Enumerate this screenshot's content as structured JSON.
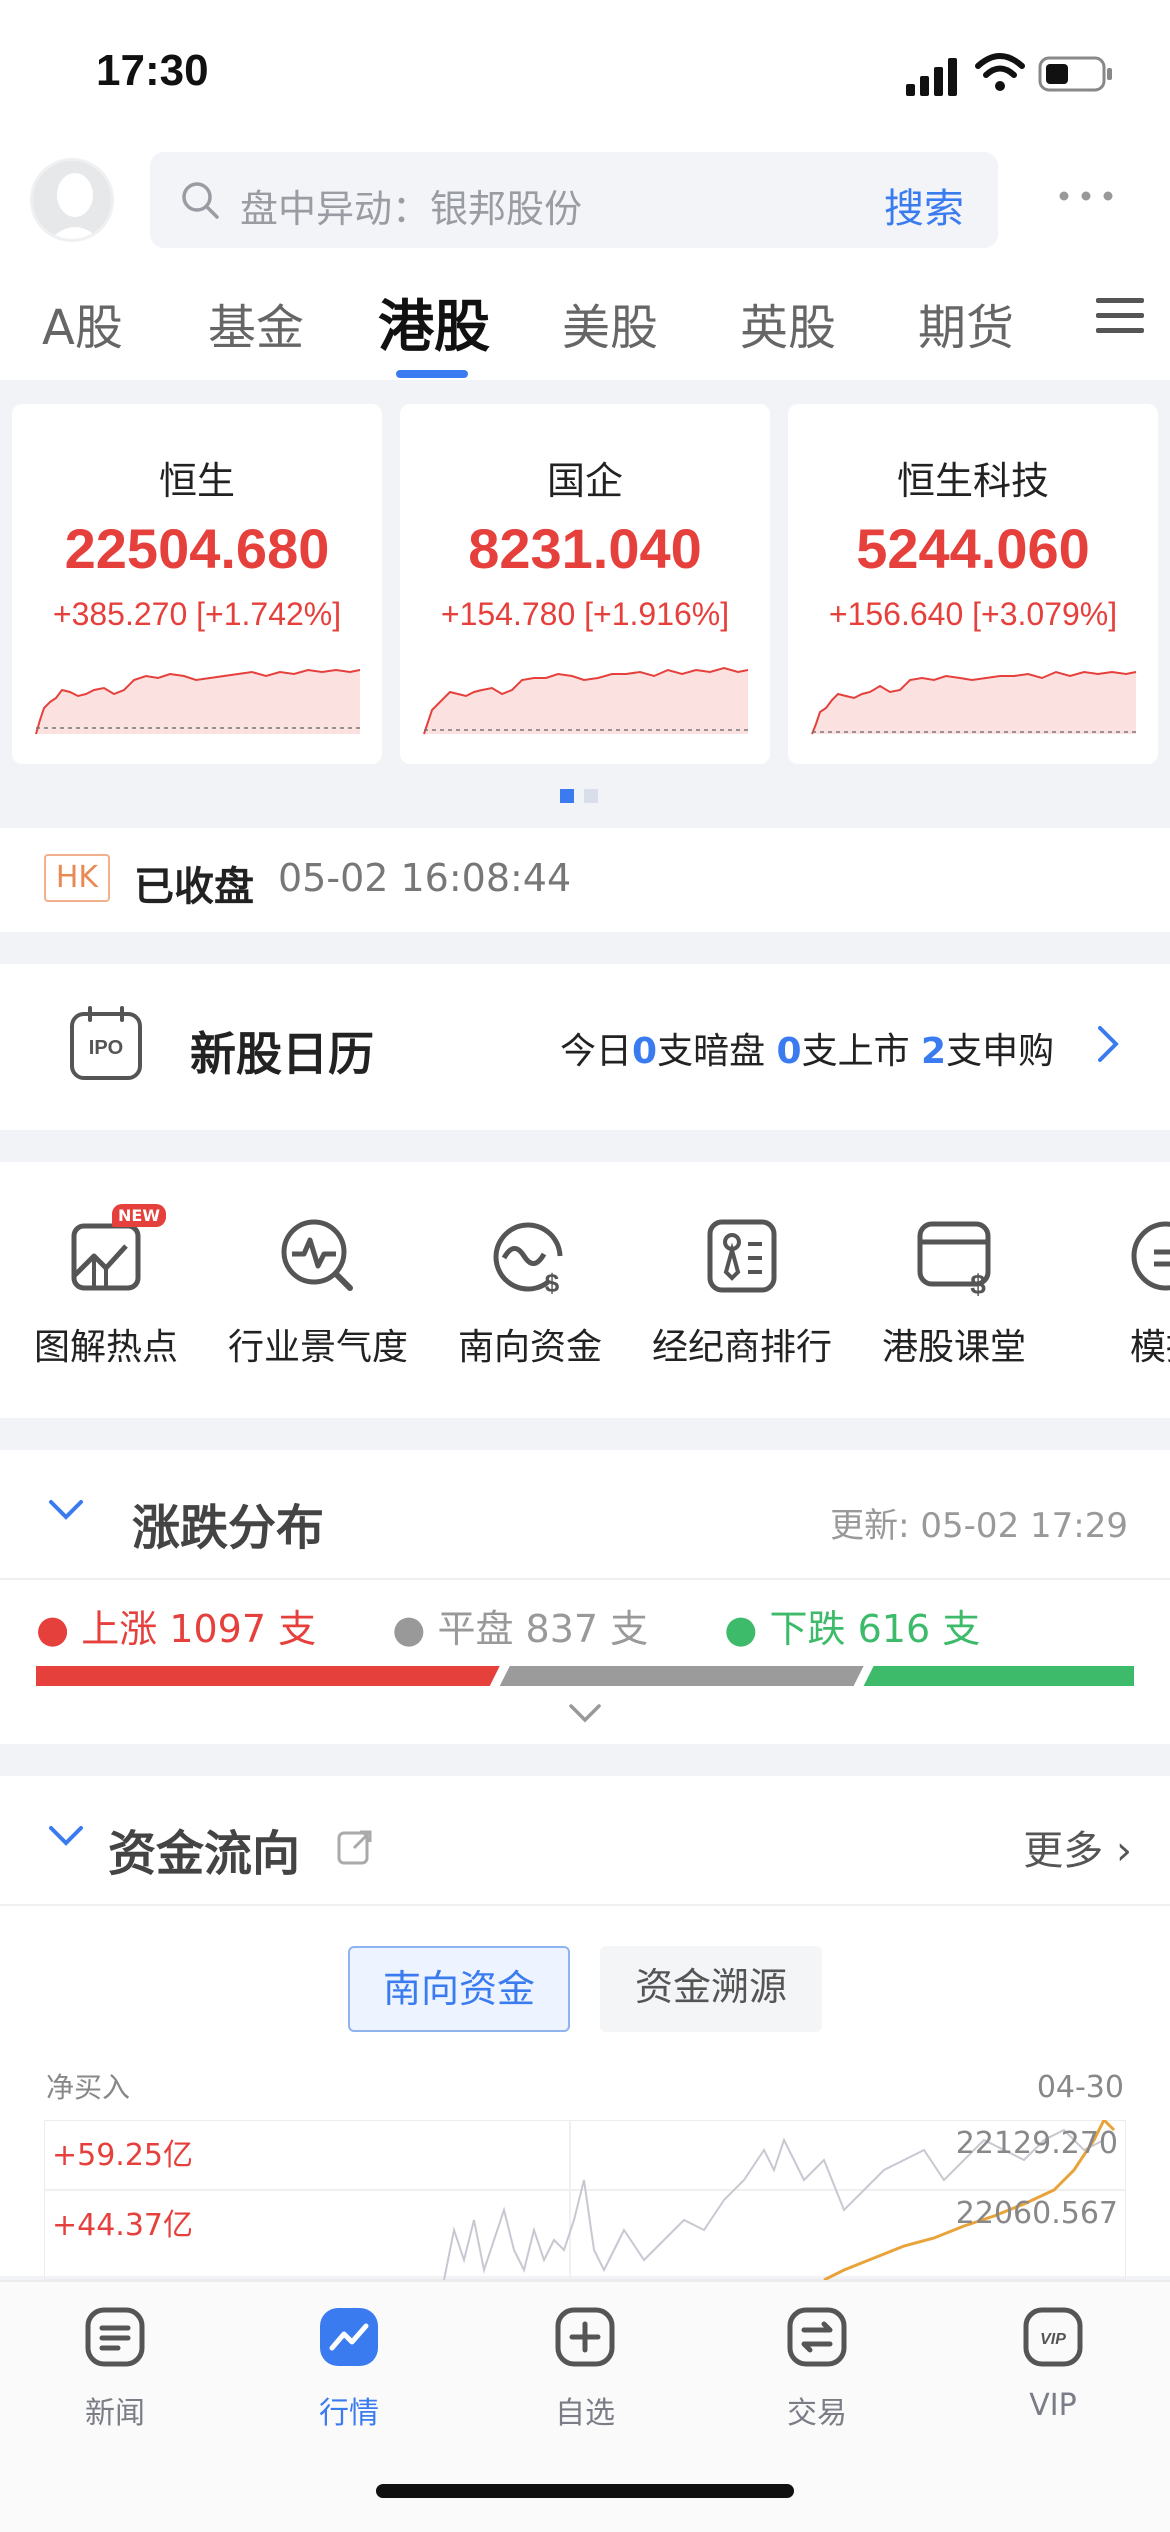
{
  "status_bar": {
    "time": "17:30"
  },
  "header": {
    "search_placeholder": "盘中异动：银邦股份",
    "search_button": "搜索",
    "tabs": [
      "A股",
      "基金",
      "港股",
      "美股",
      "英股",
      "期货"
    ],
    "active_tab": "港股"
  },
  "indices": [
    {
      "name": "恒生",
      "value": "22504.680",
      "change": "+385.270 [+1.742%]"
    },
    {
      "name": "国企",
      "value": "8231.040",
      "change": "+154.780 [+1.916%]"
    },
    {
      "name": "恒生科技",
      "value": "5244.060",
      "change": "+156.640 [+3.079%]"
    }
  ],
  "market_status": {
    "badge": "HK",
    "status": "已收盘",
    "datetime": "05-02 16:08:44"
  },
  "ipo": {
    "title": "新股日历",
    "t1": "今日",
    "n1": "0",
    "t2": "支暗盘 ",
    "n2": "0",
    "t3": "支上市 ",
    "n3": "2",
    "t4": "支申购"
  },
  "shortcuts": [
    {
      "label": "图解热点",
      "icon": "chart-hotspot-icon",
      "badge": "NEW"
    },
    {
      "label": "行业景气度",
      "icon": "industry-pulse-icon"
    },
    {
      "label": "南向资金",
      "icon": "southbound-fund-icon"
    },
    {
      "label": "经纪商排行",
      "icon": "broker-rank-icon"
    },
    {
      "label": "港股课堂",
      "icon": "hk-class-icon"
    },
    {
      "label": "模拟",
      "icon": "simulate-icon"
    }
  ],
  "distribution": {
    "title": "涨跌分布",
    "updated": "更新: 05-02 17:29",
    "up_label": "上涨 1097 支",
    "flat_label": "平盘 837 支",
    "down_label": "下跌 616 支",
    "up": 1097,
    "flat": 837,
    "down": 616,
    "colors": {
      "up": "#e5403c",
      "flat": "#9b9b9b",
      "down": "#3dba6a"
    }
  },
  "capital_flow": {
    "title": "资金流向",
    "more": "更多",
    "segments": [
      "南向资金",
      "资金溯源"
    ],
    "y_label": "净买入",
    "date": "04-30",
    "left_values": [
      "+59.25亿",
      "+44.37亿"
    ],
    "right_values": [
      "22129.270",
      "22060.567"
    ]
  },
  "tabbar": [
    {
      "label": "新闻",
      "icon": "news-icon"
    },
    {
      "label": "行情",
      "icon": "market-icon"
    },
    {
      "label": "自选",
      "icon": "watchlist-icon"
    },
    {
      "label": "交易",
      "icon": "trade-icon"
    },
    {
      "label": "VIP",
      "icon": "vip-icon"
    }
  ],
  "tabbar_active": "行情"
}
